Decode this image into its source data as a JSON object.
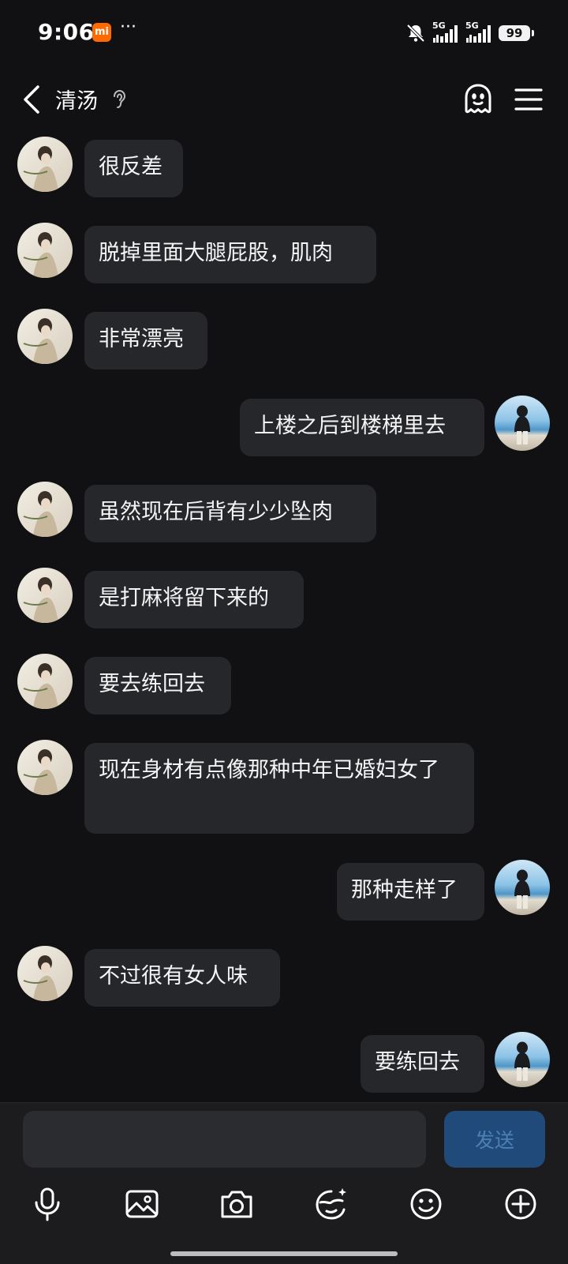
{
  "status_bar": {
    "time": "9:06",
    "brand_badge": "mi",
    "more_dots": "···",
    "signal_1_label": "5G",
    "signal_2_label": "5G",
    "battery_level": "99"
  },
  "header": {
    "title": "清汤",
    "back_icon": "chevron-left-icon",
    "ear_icon": "ear-icon",
    "robot_icon": "ghost-bot-icon",
    "menu_icon": "hamburger-menu-icon"
  },
  "messages": [
    {
      "side": "left",
      "text": "很反差"
    },
    {
      "side": "left",
      "text": "脱掉里面大腿屁股，肌肉"
    },
    {
      "side": "left",
      "text": "非常漂亮"
    },
    {
      "side": "right",
      "text": "上楼之后到楼梯里去"
    },
    {
      "side": "left",
      "text": "虽然现在后背有少少坠肉"
    },
    {
      "side": "left",
      "text": "是打麻将留下来的"
    },
    {
      "side": "left",
      "text": "要去练回去"
    },
    {
      "side": "left",
      "text": "现在身材有点像那种中年已婚妇女了"
    },
    {
      "side": "right",
      "text": "那种走样了"
    },
    {
      "side": "left",
      "text": "不过很有女人味"
    },
    {
      "side": "right",
      "text": "要练回去"
    }
  ],
  "composer": {
    "input_value": "",
    "send_label": "发送"
  },
  "toolbar_icons": [
    "microphone-icon",
    "image-icon",
    "camera-icon",
    "sticker-icon",
    "emoji-icon",
    "plus-icon"
  ],
  "colors": {
    "background": "#111113",
    "bubble": "#26272b",
    "send_button": "#1f4a79",
    "send_text": "#4d81b5"
  }
}
